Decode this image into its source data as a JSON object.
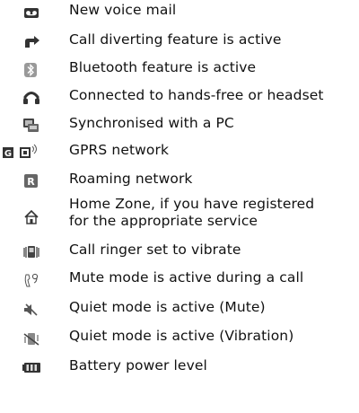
{
  "legend": {
    "items": [
      {
        "icon": "voicemail-icon",
        "label": "New voice mail"
      },
      {
        "icon": "call-divert-icon",
        "label": "Call diverting feature is active"
      },
      {
        "icon": "bluetooth-icon",
        "label": "Bluetooth feature is active"
      },
      {
        "icon": "headset-icon",
        "label": "Connected to hands-free or headset"
      },
      {
        "icon": "pc-sync-icon",
        "label": "Synchronised with a PC"
      },
      {
        "icon": "gprs-icon",
        "label": "GPRS network"
      },
      {
        "icon": "roaming-icon",
        "label": "Roaming network"
      },
      {
        "icon": "home-zone-icon",
        "label_lines": [
          "Home Zone, if you have registered",
          "for the appropriate service"
        ]
      },
      {
        "icon": "vibrate-icon",
        "label": "Call ringer set to vibrate"
      },
      {
        "icon": "mute-call-icon",
        "label": "Mute mode is active during a call"
      },
      {
        "icon": "quiet-mute-icon",
        "label": "Quiet mode is active (Mute)"
      },
      {
        "icon": "quiet-vibration-icon",
        "label": "Quiet mode is active (Vibration)"
      },
      {
        "icon": "battery-icon",
        "label": "Battery power level"
      }
    ]
  },
  "colors": {
    "icon_dark": "#333333",
    "icon_mid": "#777777",
    "icon_light": "#bbbbbb",
    "text": "#111111"
  }
}
